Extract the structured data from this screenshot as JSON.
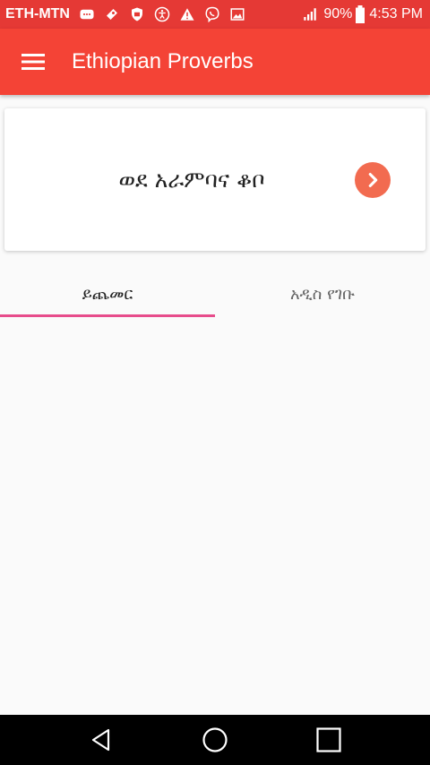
{
  "status_bar": {
    "carrier": "ETH-MTN",
    "battery": "90%",
    "time": "4:53 PM",
    "icons": [
      "message-icon",
      "app-icon",
      "shield-icon",
      "accessibility-icon",
      "warning-icon",
      "viber-icon",
      "image-icon",
      "signal-icon",
      "battery-icon"
    ]
  },
  "app_bar": {
    "title": "Ethiopian Proverbs",
    "menu_icon": "menu-icon",
    "color": "#f44336"
  },
  "card": {
    "text": "ወደ አራምባና ቆቦ",
    "arrow_icon": "chevron-right-icon",
    "arrow_color": "#f26b50"
  },
  "tabs": {
    "items": [
      {
        "label": "ይጨመር",
        "active": true
      },
      {
        "label": "አዲስ የገቡ",
        "active": false
      }
    ],
    "indicator_color": "#e74c8b"
  },
  "nav_bar": {
    "icons": [
      "back-icon",
      "home-icon",
      "recent-apps-icon"
    ]
  }
}
